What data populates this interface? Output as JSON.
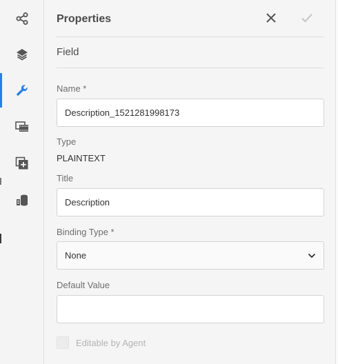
{
  "panel": {
    "title": "Properties",
    "section": "Field"
  },
  "rail": {
    "items": [
      {
        "icon": "share-icon",
        "active": false
      },
      {
        "icon": "layers-icon",
        "active": false
      },
      {
        "icon": "wrench-icon",
        "active": true
      },
      {
        "icon": "film-strip-icon",
        "active": false
      },
      {
        "icon": "add-component-icon",
        "active": false
      },
      {
        "icon": "data-source-icon",
        "active": false
      }
    ]
  },
  "form": {
    "name_label": "Name *",
    "name_value": "Description_1521281998173",
    "type_label": "Type",
    "type_value": "PLAINTEXT",
    "title_label": "Title",
    "title_value": "Description",
    "binding_label": "Binding Type *",
    "binding_value": "None",
    "default_label": "Default Value",
    "default_value": "",
    "editable_label": "Editable by Agent",
    "editable_checked": false
  },
  "colors": {
    "accent": "#2680eb",
    "text": "#4b4b4b",
    "muted": "#6e6e6e",
    "disabled": "#b3b3b3"
  }
}
